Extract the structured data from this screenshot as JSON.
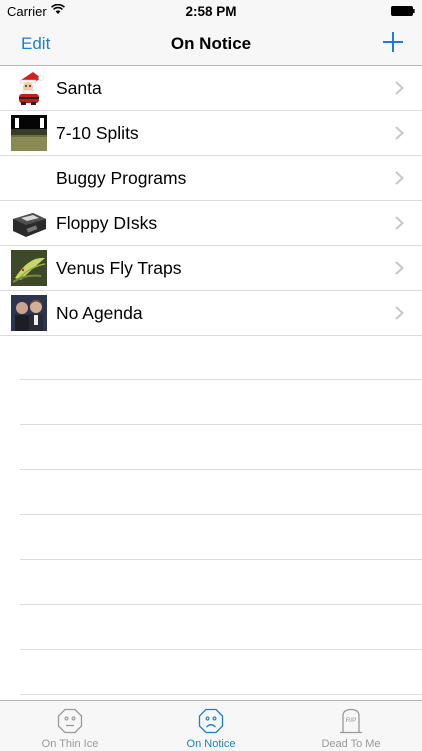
{
  "status": {
    "carrier": "Carrier",
    "time": "2:58 PM"
  },
  "nav": {
    "edit_label": "Edit",
    "title": "On Notice",
    "add_icon": "plus-icon"
  },
  "rows": [
    {
      "label": "Santa",
      "thumb": "santa-image"
    },
    {
      "label": "7-10 Splits",
      "thumb": "bowling-image"
    },
    {
      "label": "Buggy Programs",
      "thumb": ""
    },
    {
      "label": "Floppy DIsks",
      "thumb": "floppy-disk-image"
    },
    {
      "label": "Venus Fly Traps",
      "thumb": "venus-fly-trap-image"
    },
    {
      "label": "No Agenda",
      "thumb": "no-agenda-image"
    }
  ],
  "tabs": [
    {
      "label": "On Thin Ice",
      "icon": "neutral-face-icon",
      "active": false
    },
    {
      "label": "On Notice",
      "icon": "frown-face-icon",
      "active": true
    },
    {
      "label": "Dead To Me",
      "icon": "tombstone-icon",
      "active": false,
      "icon_text": "RIP"
    }
  ],
  "colors": {
    "accent": "#1a7ed3",
    "inactive": "#999999",
    "separator": "#dcdcde",
    "bar": "#f7f7f7"
  }
}
